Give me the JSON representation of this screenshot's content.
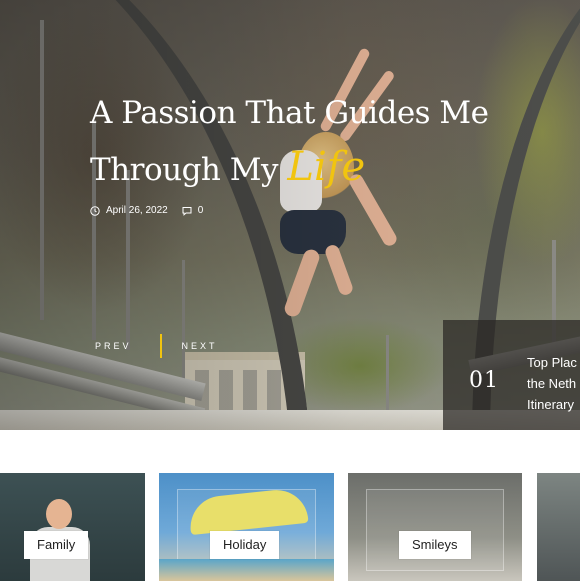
{
  "hero": {
    "title_line1": "A Passion That Guides Me",
    "title_line2_prefix": "Through My ",
    "title_accent": "Life",
    "date": "April 26, 2022",
    "comments": "0",
    "prev_label": "PREV",
    "next_label": "NEXT",
    "accent_color": "#f1c40f"
  },
  "next_slide": {
    "number": "01",
    "title": "Top Plac\nthe Neth\nItinerary"
  },
  "categories": [
    {
      "label": "Family"
    },
    {
      "label": "Holiday"
    },
    {
      "label": "Smileys"
    }
  ],
  "icons": {
    "date": "clock-icon",
    "comments": "comment-icon"
  }
}
